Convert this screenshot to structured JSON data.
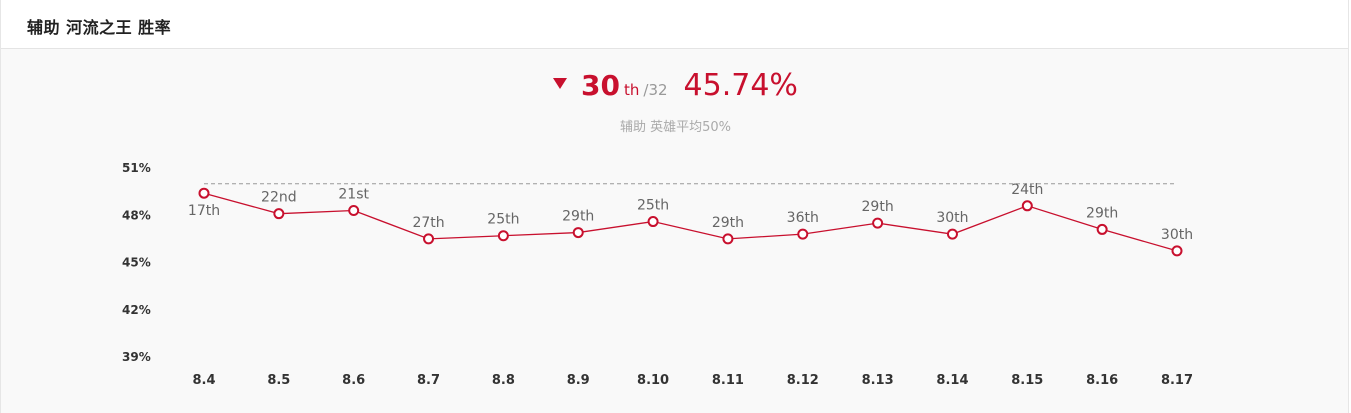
{
  "header": {
    "title": "辅助 河流之王 胜率"
  },
  "summary": {
    "rank": "30",
    "rank_suffix": "th",
    "rank_total": "/32",
    "win_rate": "45.74%",
    "caption": "辅助 英雄平均50%",
    "trend": "down",
    "accent_color": "#c8102e"
  },
  "chart_data": {
    "type": "line",
    "x": [
      "8.4",
      "8.5",
      "8.6",
      "8.7",
      "8.8",
      "8.9",
      "8.10",
      "8.11",
      "8.12",
      "8.13",
      "8.14",
      "8.15",
      "8.16",
      "8.17"
    ],
    "series": [
      {
        "values": [
          49.4,
          48.1,
          48.3,
          46.5,
          46.7,
          46.9,
          47.6,
          46.5,
          46.8,
          47.5,
          46.8,
          48.6,
          47.1,
          45.74
        ],
        "point_labels": [
          "17th",
          "22nd",
          "21st",
          "27th",
          "25th",
          "29th",
          "25th",
          "29th",
          "36th",
          "29th",
          "30th",
          "24th",
          "29th",
          "30th"
        ],
        "color": "#c8102e"
      }
    ],
    "reference_line": {
      "value": 50,
      "style": "dashed",
      "color": "#999999"
    },
    "yticks": [
      "51%",
      "48%",
      "45%",
      "42%",
      "39%"
    ],
    "ylim": [
      39,
      51
    ],
    "grid": false
  }
}
